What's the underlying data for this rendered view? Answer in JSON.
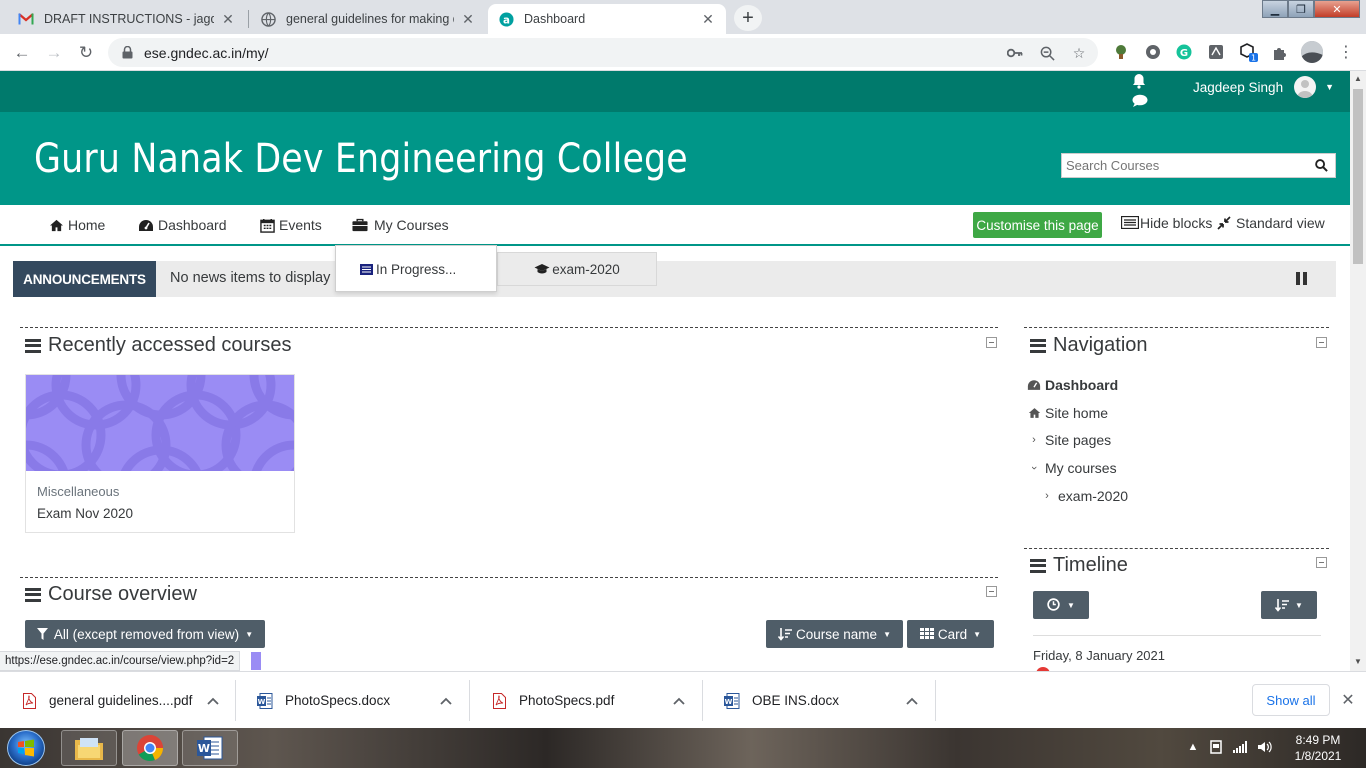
{
  "browser": {
    "tabs": [
      {
        "title": "DRAFT INSTRUCTIONS - jagdeep",
        "icon": "gmail-icon"
      },
      {
        "title": "general guidelines for making qu",
        "icon": "globe-icon"
      },
      {
        "title": "Dashboard",
        "icon": "moodle-icon"
      }
    ],
    "url": "ese.gndec.ac.in/my/",
    "status_url": "https://ese.gndec.ac.in/course/view.php?id=2"
  },
  "site": {
    "name": "Guru Nanak Dev Engineering College",
    "search_placeholder": "Search Courses",
    "user_name": "Jagdeep Singh",
    "theme_colors": {
      "topbar": "#007a6c",
      "banner": "#009688",
      "announce_label": "#34495e",
      "customise": "#3ea845"
    }
  },
  "nav": {
    "home": "Home",
    "dashboard": "Dashboard",
    "events": "Events",
    "my_courses": "My Courses",
    "customise": "Customise this page",
    "hide_blocks": "Hide blocks",
    "standard_view": "Standard view"
  },
  "dropdown": {
    "in_progress": "In Progress...",
    "exam": "exam-2020"
  },
  "announcements": {
    "label": "ANNOUNCEMENTS",
    "message": "No news items to display"
  },
  "recent": {
    "title": "Recently accessed courses",
    "course": {
      "category": "Miscellaneous",
      "name": "Exam Nov 2020"
    }
  },
  "overview": {
    "title": "Course overview",
    "filter": "All (except removed from view)",
    "sort": "Course name",
    "view": "Card"
  },
  "navigation": {
    "title": "Navigation",
    "items": [
      "Dashboard",
      "Site home",
      "Site pages",
      "My courses",
      "exam-2020"
    ]
  },
  "timeline": {
    "title": "Timeline",
    "date": "Friday, 8 January 2021"
  },
  "downloads": [
    {
      "name": "general guidelines....pdf",
      "type": "pdf"
    },
    {
      "name": "PhotoSpecs.docx",
      "type": "docx"
    },
    {
      "name": "PhotoSpecs.pdf",
      "type": "pdf"
    },
    {
      "name": "OBE INS.docx",
      "type": "docx"
    }
  ],
  "downloads_show_all": "Show all",
  "taskbar": {
    "time": "8:49 PM",
    "date": "1/8/2021"
  }
}
